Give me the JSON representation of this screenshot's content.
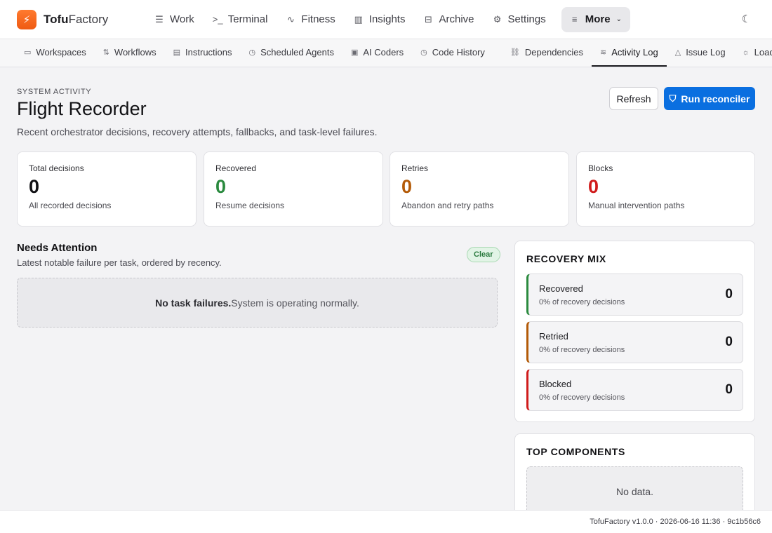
{
  "brand": {
    "name_strong": "Tofu",
    "name_rest": "Factory",
    "logo_icon": "bolt-icon"
  },
  "topnav": [
    {
      "label": "Work",
      "icon": "list-icon",
      "glyph": "☰"
    },
    {
      "label": "Terminal",
      "icon": "terminal-icon",
      "glyph": ">_"
    },
    {
      "label": "Fitness",
      "icon": "pulse-icon",
      "glyph": "∿"
    },
    {
      "label": "Insights",
      "icon": "bar-chart-icon",
      "glyph": "▥"
    },
    {
      "label": "Archive",
      "icon": "archive-icon",
      "glyph": "⊟"
    },
    {
      "label": "Settings",
      "icon": "gear-icon",
      "glyph": "⚙"
    },
    {
      "label": "More",
      "icon": "menu-icon",
      "glyph": "≡"
    }
  ],
  "theme_toggle_icon": "moon-icon",
  "subnav": [
    {
      "label": "Workspaces",
      "icon": "folder-icon",
      "glyph": "▭"
    },
    {
      "label": "Workflows",
      "icon": "workflow-icon",
      "glyph": "⇅"
    },
    {
      "label": "Instructions",
      "icon": "document-icon",
      "glyph": "▤"
    },
    {
      "label": "Scheduled Agents",
      "icon": "clock-icon",
      "glyph": "◷"
    },
    {
      "label": "AI Coders",
      "icon": "chip-icon",
      "glyph": "▣"
    },
    {
      "label": "Code History",
      "icon": "history-icon",
      "glyph": "◷"
    },
    {
      "label": "Dependencies",
      "icon": "link-icon",
      "glyph": "⛓"
    },
    {
      "label": "Activity Log",
      "icon": "wifi-icon",
      "glyph": "≋"
    },
    {
      "label": "Issue Log",
      "icon": "warning-icon",
      "glyph": "△"
    },
    {
      "label": "Load Test",
      "icon": "sun-icon",
      "glyph": "☼"
    }
  ],
  "header": {
    "eyebrow": "SYSTEM ACTIVITY",
    "title": "Flight Recorder",
    "subtitle": "Recent orchestrator decisions, recovery attempts, fallbacks, and task-level failures.",
    "refresh_label": "Refresh",
    "run_label": "Run reconciler",
    "run_icon": "shield-icon"
  },
  "stats": [
    {
      "label": "Total decisions",
      "value": "0",
      "caption": "All recorded decisions",
      "color": "#111114"
    },
    {
      "label": "Recovered",
      "value": "0",
      "caption": "Resume decisions",
      "color": "#2a8a3e"
    },
    {
      "label": "Retries",
      "value": "0",
      "caption": "Abandon and retry paths",
      "color": "#b35a07"
    },
    {
      "label": "Blocks",
      "value": "0",
      "caption": "Manual intervention paths",
      "color": "#d01b1b"
    }
  ],
  "needs_attention": {
    "title": "Needs Attention",
    "subtitle": "Latest notable failure per task, ordered by recency.",
    "badge": "Clear",
    "empty_strong": "No task failures.",
    "empty_rest": "System is operating normally."
  },
  "recovery_mix": {
    "title": "RECOVERY MIX",
    "items": [
      {
        "name": "Recovered",
        "pct": "0% of recovery decisions",
        "count": "0",
        "color": "#2a8a3e"
      },
      {
        "name": "Retried",
        "pct": "0% of recovery decisions",
        "count": "0",
        "color": "#b35a07"
      },
      {
        "name": "Blocked",
        "pct": "0% of recovery decisions",
        "count": "0",
        "color": "#d01b1b"
      }
    ]
  },
  "top_components": {
    "title": "TOP COMPONENTS",
    "empty": "No data."
  },
  "footer": "TofuFactory v1.0.0 · 2026-06-16 11:36 · 9c1b56c6"
}
